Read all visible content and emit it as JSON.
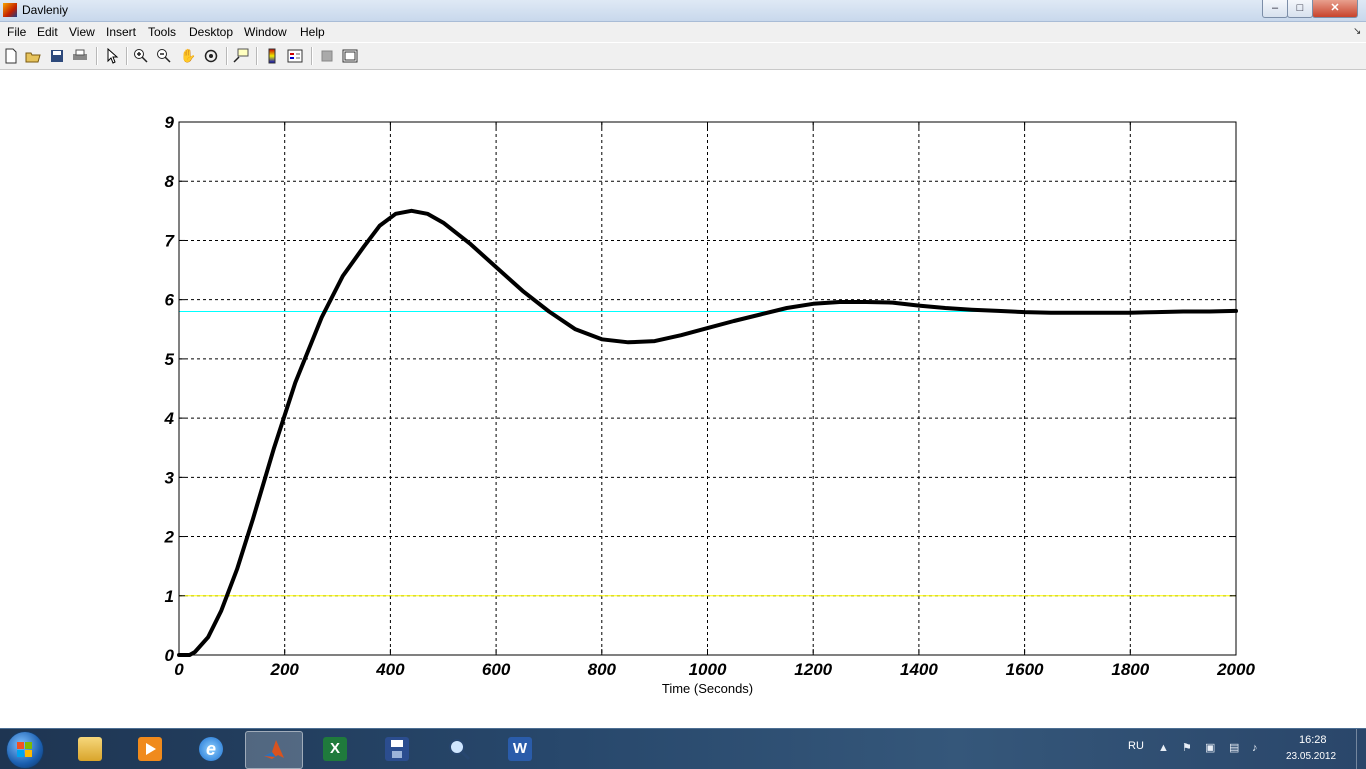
{
  "window": {
    "title": "Davleniy",
    "min_label": "–",
    "max_label": "□",
    "close_label": "✕"
  },
  "menu": [
    {
      "id": "file",
      "label": "File"
    },
    {
      "id": "edit",
      "label": "Edit"
    },
    {
      "id": "view",
      "label": "View"
    },
    {
      "id": "insert",
      "label": "Insert"
    },
    {
      "id": "tools",
      "label": "Tools"
    },
    {
      "id": "desktop",
      "label": "Desktop"
    },
    {
      "id": "window",
      "label": "Window"
    },
    {
      "id": "help",
      "label": "Help"
    }
  ],
  "toolbar_icons": [
    "new-figure-icon",
    "open-file-icon",
    "save-icon",
    "print-icon",
    "select-arrow-icon",
    "zoom-in-icon",
    "zoom-out-icon",
    "pan-hand-icon",
    "rotate-3d-icon",
    "data-cursor-icon",
    "colorbar-icon",
    "legend-icon",
    "hide-plot-tools-icon",
    "show-plot-tools-icon"
  ],
  "chart_data": {
    "type": "line",
    "title": "",
    "xlabel": "Time (Seconds)",
    "ylabel": "",
    "xlim": [
      0,
      2000
    ],
    "ylim": [
      0,
      9
    ],
    "xticks": [
      0,
      200,
      400,
      600,
      800,
      1000,
      1200,
      1400,
      1600,
      1800,
      2000
    ],
    "yticks": [
      0,
      1,
      2,
      3,
      4,
      5,
      6,
      7,
      8,
      9
    ],
    "grid": true,
    "series": [
      {
        "color": "#ffff00",
        "width": 1,
        "x": [
          0,
          0,
          2000
        ],
        "y": [
          0,
          1,
          1
        ]
      },
      {
        "color": "#00ffff",
        "width": 1,
        "x": [
          0,
          2000
        ],
        "y": [
          5.8,
          5.8
        ]
      },
      {
        "color": "#000000",
        "width": 4,
        "x": [
          0,
          20,
          30,
          55,
          80,
          110,
          140,
          180,
          220,
          270,
          310,
          350,
          380,
          410,
          440,
          470,
          500,
          550,
          600,
          650,
          700,
          750,
          800,
          850,
          900,
          950,
          1000,
          1050,
          1100,
          1150,
          1200,
          1250,
          1300,
          1350,
          1400,
          1450,
          1500,
          1550,
          1600,
          1650,
          1700,
          1750,
          1800,
          1850,
          1900,
          1950,
          2000
        ],
        "y": [
          0,
          0,
          0.05,
          0.3,
          0.75,
          1.45,
          2.3,
          3.5,
          4.6,
          5.7,
          6.4,
          6.9,
          7.25,
          7.45,
          7.5,
          7.45,
          7.3,
          6.95,
          6.55,
          6.15,
          5.8,
          5.5,
          5.33,
          5.28,
          5.3,
          5.4,
          5.52,
          5.64,
          5.75,
          5.86,
          5.93,
          5.96,
          5.96,
          5.95,
          5.9,
          5.86,
          5.83,
          5.81,
          5.79,
          5.78,
          5.78,
          5.78,
          5.78,
          5.79,
          5.8,
          5.8,
          5.81
        ]
      }
    ]
  },
  "taskbar": {
    "apps": [
      "file-explorer",
      "media-player",
      "internet-explorer",
      "matlab",
      "excel",
      "save-disk",
      "search-tool",
      "word"
    ],
    "language": "RU",
    "time": "16:28",
    "date": "23.05.2012"
  }
}
